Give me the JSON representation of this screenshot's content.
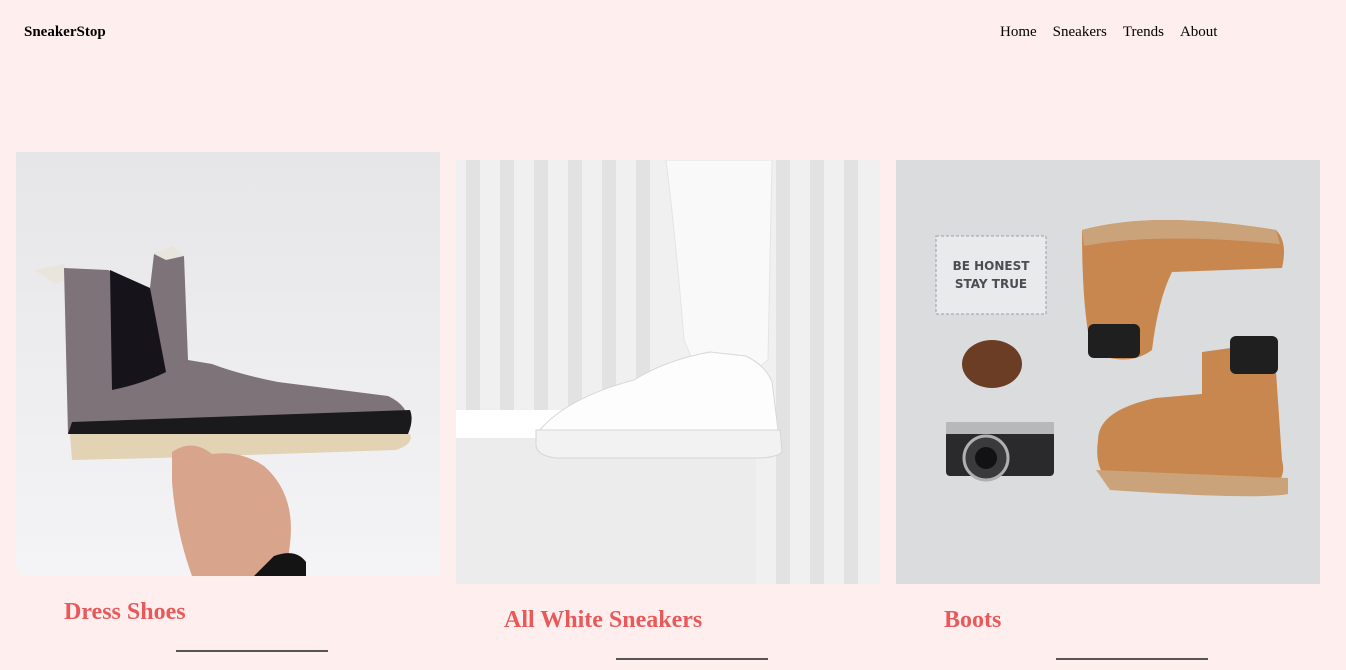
{
  "header": {
    "brand": "SneakerStop",
    "nav": [
      "Home",
      "Sneakers",
      "Trends",
      "About"
    ]
  },
  "cards": [
    {
      "title": "Dress Shoes",
      "image": "grey-suede-chelsea-boot-photo"
    },
    {
      "title": "All White Sneakers",
      "image": "white-sneaker-photo"
    },
    {
      "title": "Boots",
      "image": "tan-boots-flatlay-photo",
      "sign_text": [
        "BE HONEST",
        "STAY TRUE"
      ]
    }
  ],
  "colors": {
    "background": "#ffeeee",
    "accent": "#e8595a",
    "rule": "#555555"
  }
}
